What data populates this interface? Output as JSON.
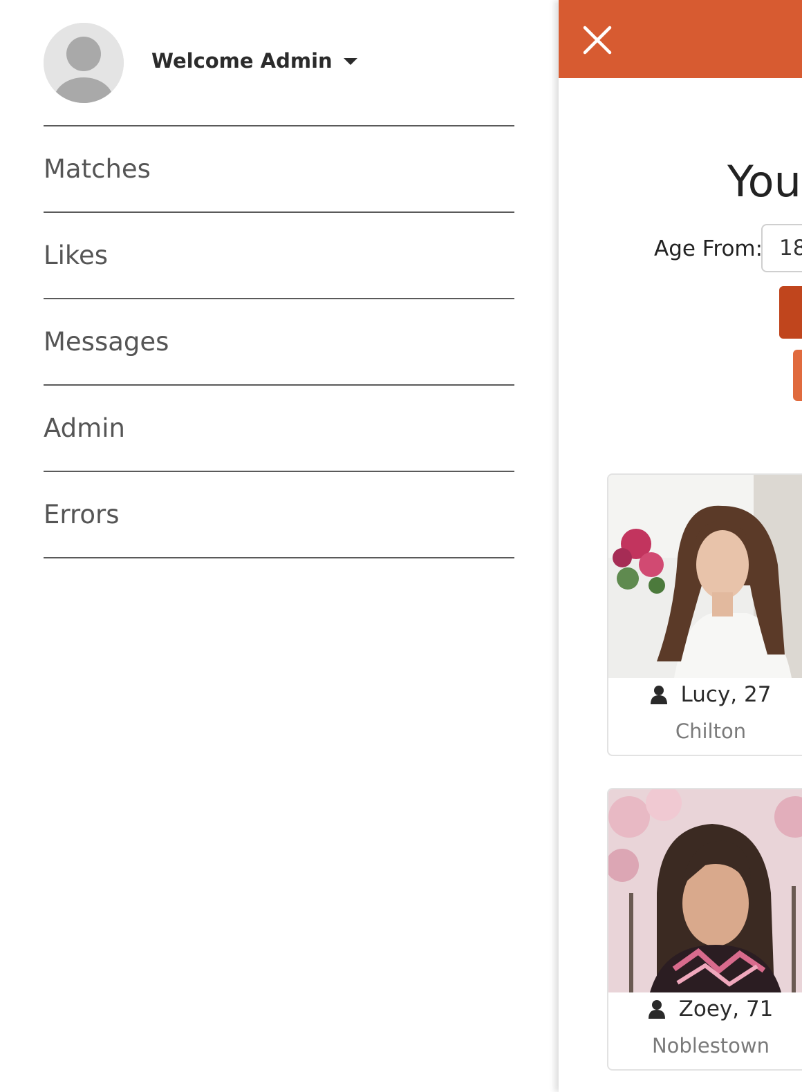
{
  "drawer": {
    "welcome_text": "Welcome Admin",
    "nav_items": [
      {
        "label": "Matches"
      },
      {
        "label": "Likes"
      },
      {
        "label": "Messages"
      },
      {
        "label": "Admin"
      },
      {
        "label": "Errors"
      }
    ]
  },
  "main": {
    "heading": "You",
    "filters": {
      "age_from_label": "Age From:",
      "age_from_value": "18"
    },
    "members": [
      {
        "name_age": "Lucy, 27",
        "city": "Chilton"
      },
      {
        "name_age": "Zoey, 71",
        "city": "Noblestown"
      }
    ]
  },
  "colors": {
    "accent": "#d75b31",
    "button_primary": "#c0451d",
    "button_secondary": "#e06a3d"
  },
  "icons": [
    "user-avatar-icon",
    "chevron-down-icon",
    "close-icon",
    "user-icon"
  ]
}
